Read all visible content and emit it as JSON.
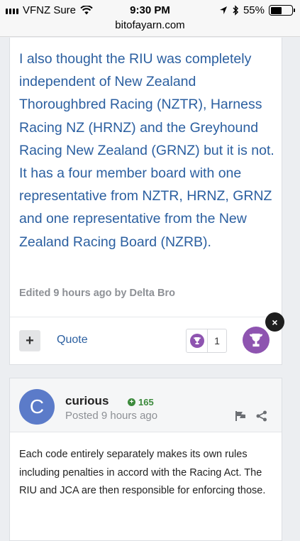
{
  "status_bar": {
    "carrier": "VFNZ Sure",
    "time": "9:30 PM",
    "battery": "55%",
    "battery_level": 0.55,
    "url": "bitofayarn.com"
  },
  "post1": {
    "body": "I also thought the RIU was completely independent of New Zealand Thoroughbred Racing (NZTR), Harness Racing NZ (HRNZ) and the Greyhound Racing New Zealand (GRNZ) but it is not. It has a four member board with one representative from NZTR, HRNZ, GRNZ and one representative from the New Zealand Racing Board (NZRB).",
    "edited": "Edited 9 hours ago by Delta Bro",
    "plus_label": "+",
    "quote_label": "Quote",
    "reaction_count": "1",
    "close_label": "×"
  },
  "post2": {
    "avatar_letter": "C",
    "author": "curious",
    "reputation": "165",
    "posted": "Posted 9 hours ago",
    "body": "Each code entirely separately makes its own rules including penalties in accord with the Racing Act. The RIU and JCA are then responsible for enforcing those."
  },
  "colors": {
    "link_blue": "#2b5fa0",
    "trophy_purple": "#8e54b0",
    "rep_green": "#3c8a3c",
    "avatar_blue": "#5b7bc9"
  }
}
